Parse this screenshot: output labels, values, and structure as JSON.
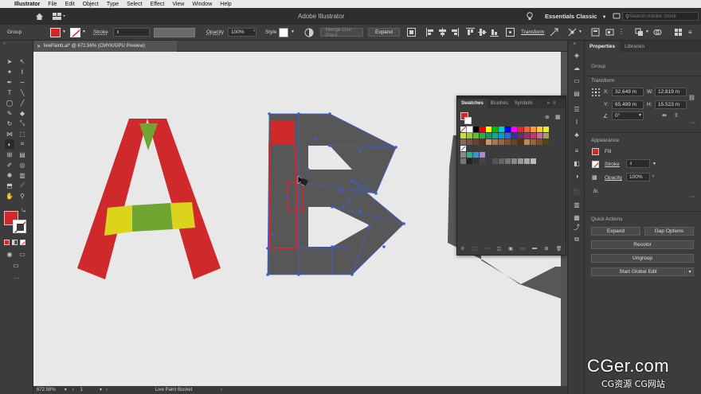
{
  "menubar": {
    "app_name": "Illustrator",
    "items": [
      "File",
      "Edit",
      "Object",
      "Type",
      "Select",
      "Effect",
      "View",
      "Window",
      "Help"
    ]
  },
  "appbar": {
    "title": "Adobe Illustrator",
    "workspace": "Essentials Classic",
    "search_placeholder": "Search Adobe Stock"
  },
  "control_bar": {
    "selection_label": "Group",
    "stroke_label": "Stroke",
    "opacity_label": "Opacity",
    "opacity_value": "100%",
    "style_label": "Style",
    "merge_label": "Merge Live Paint",
    "expand_label": "Expand",
    "transform_label": "Transform"
  },
  "document_tab": {
    "title": "livePaintLai* @ 672.56% (CMYK/GPU Preview)"
  },
  "status_bar": {
    "zoom": "672.56%",
    "artboard": "1",
    "tool": "Live Paint Bucket"
  },
  "properties_panel": {
    "tabs": [
      "Properties",
      "Libraries"
    ],
    "selection": "Group",
    "transform_title": "Transform",
    "x_label": "X:",
    "x_value": "32.649 m",
    "y_label": "Y:",
    "y_value": "65.489 m",
    "w_label": "W:",
    "w_value": "12.819 m",
    "h_label": "H:",
    "h_value": "15.523 m",
    "angle_value": "0°",
    "appearance_title": "Appearance",
    "fill_label": "Fill",
    "stroke_label": "Stroke",
    "opacity_label": "Opacity",
    "opacity_value": "100%",
    "fx_label": "fx.",
    "quick_actions_title": "Quick Actions",
    "expand_button": "Expand",
    "gap_options_button": "Gap Options",
    "recolor_button": "Recolor",
    "ungroup_button": "Ungroup",
    "start_global_edit_button": "Start Global Edit"
  },
  "swatches_panel": {
    "tabs": [
      "Swatches",
      "Brushes",
      "Symbols"
    ]
  },
  "watermark": {
    "line1": "CGer.com",
    "line2": "CG资源 CG网站"
  },
  "colors": {
    "fill_red": "#d0292b",
    "letter_green": "#71a532",
    "letter_yellow": "#dcd41a",
    "live_paint_gray": "#575757",
    "selection_blue": "#3b5fd6",
    "accent_blue": "#2f6fde"
  }
}
